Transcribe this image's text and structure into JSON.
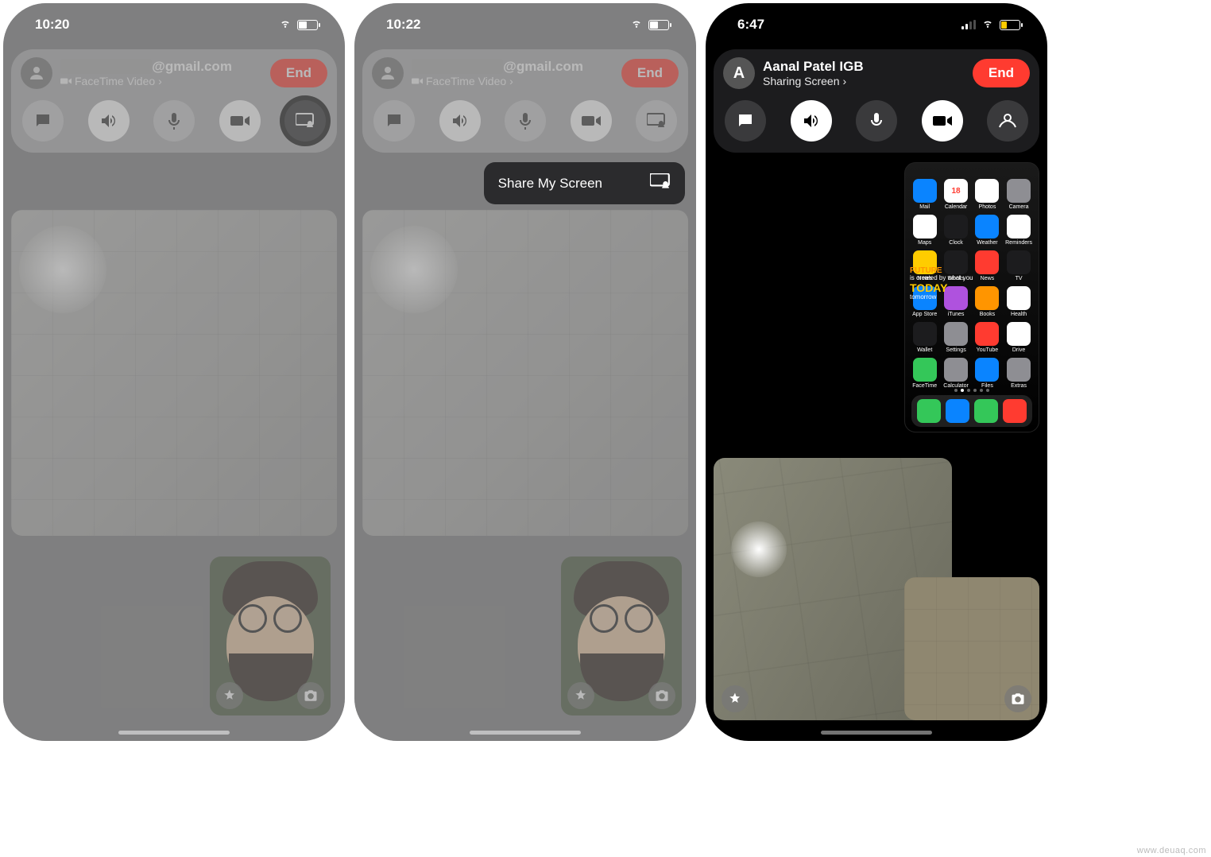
{
  "watermark": "www.deuaq.com",
  "phones": [
    {
      "time": "10:20",
      "contact_email": "@gmail.com",
      "subtitle": "FaceTime Video",
      "end_label": "End"
    },
    {
      "time": "10:22",
      "contact_email": "@gmail.com",
      "subtitle": "FaceTime Video",
      "end_label": "End",
      "popup_label": "Share My Screen"
    },
    {
      "time": "6:47",
      "contact_name": "Aanal Patel IGB",
      "avatar_initial": "A",
      "subtitle": "Sharing Screen",
      "end_label": "End"
    }
  ],
  "shared_quote": {
    "line1": "FUTURE",
    "line2": "is created by what you",
    "line3": "TODAY",
    "line4": "tomorrow"
  },
  "apps": [
    {
      "label": "Mail",
      "color": "c-blue"
    },
    {
      "label": "Calendar",
      "color": "c-white",
      "text": "18"
    },
    {
      "label": "Photos",
      "color": "c-white"
    },
    {
      "label": "Camera",
      "color": "c-grey"
    },
    {
      "label": "Maps",
      "color": "c-white"
    },
    {
      "label": "Clock",
      "color": "c-black"
    },
    {
      "label": "Weather",
      "color": "c-blue"
    },
    {
      "label": "Reminders",
      "color": "c-white"
    },
    {
      "label": "Notes",
      "color": "c-yellow"
    },
    {
      "label": "Stocks",
      "color": "c-black"
    },
    {
      "label": "News",
      "color": "c-red"
    },
    {
      "label": "TV",
      "color": "c-black"
    },
    {
      "label": "App Store",
      "color": "c-blue"
    },
    {
      "label": "iTunes",
      "color": "c-purple"
    },
    {
      "label": "Books",
      "color": "c-orange"
    },
    {
      "label": "Health",
      "color": "c-white"
    },
    {
      "label": "Wallet",
      "color": "c-black"
    },
    {
      "label": "Settings",
      "color": "c-grey"
    },
    {
      "label": "YouTube",
      "color": "c-red"
    },
    {
      "label": "Drive",
      "color": "c-white"
    },
    {
      "label": "FaceTime",
      "color": "c-green"
    },
    {
      "label": "Calculator",
      "color": "c-grey"
    },
    {
      "label": "Files",
      "color": "c-blue"
    },
    {
      "label": "Extras",
      "color": "c-grey"
    }
  ],
  "dock": [
    {
      "color": "c-green"
    },
    {
      "color": "c-blue"
    },
    {
      "color": "c-green"
    },
    {
      "color": "c-red"
    }
  ]
}
